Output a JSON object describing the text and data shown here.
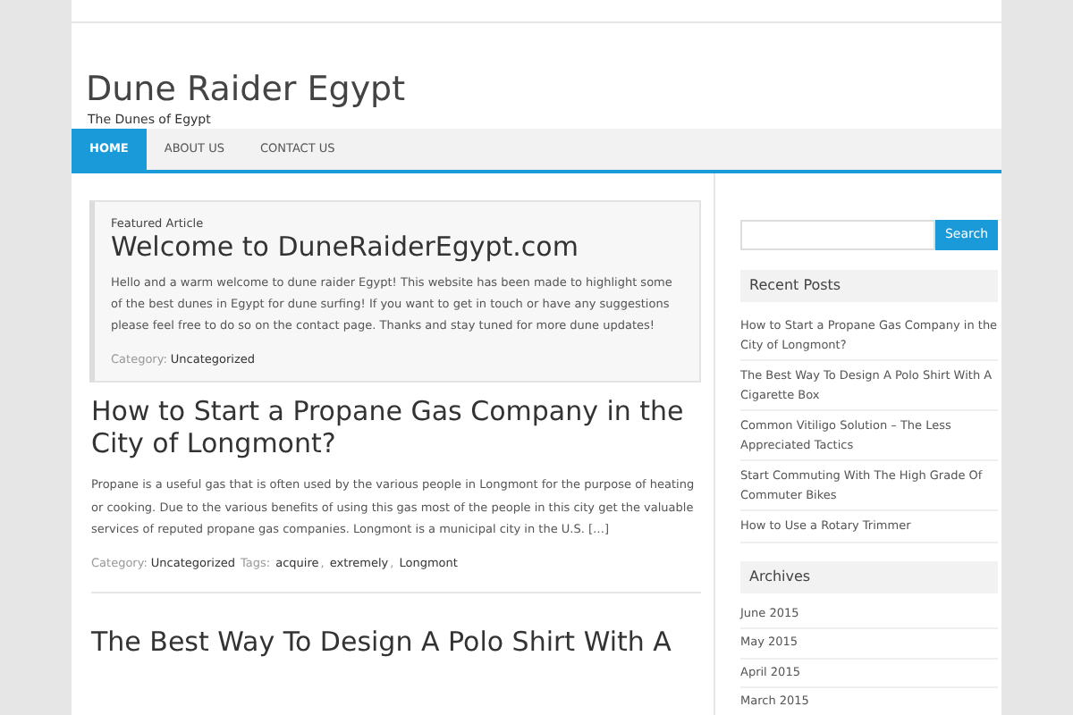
{
  "site": {
    "title": "Dune Raider Egypt",
    "tagline": "The Dunes of Egypt"
  },
  "nav": [
    {
      "label": "HOME",
      "selected": true
    },
    {
      "label": "ABOUT US",
      "selected": false
    },
    {
      "label": "CONTACT US",
      "selected": false
    }
  ],
  "featured": {
    "label": "Featured Article",
    "title": "Welcome to DuneRaiderEgypt.com",
    "body": "Hello and a warm welcome to dune raider Egypt! This website has been made to highlight some of the best dunes in Egypt for dune surfing! If you want to get in touch or have any suggestions please feel free to do so on the contact page. Thanks and stay tuned for more dune updates!",
    "category_label": "Category:",
    "category": "Uncategorized"
  },
  "posts": [
    {
      "title": "How to Start a Propane Gas Company in the City of Longmont?",
      "excerpt": "Propane is a useful gas that is often used by the various people in Longmont for the purpose of heating or cooking. Due to the various benefits of using this gas most of the people in this city get the valuable services of reputed propane gas companies. Longmont is a municipal city in the U.S. […]",
      "category_label": "Category:",
      "category": "Uncategorized",
      "tags_label": "Tags:",
      "tags": [
        "acquire",
        "extremely",
        "Longmont"
      ],
      "tag_separator": ","
    },
    {
      "title": "The Best Way To Design A Polo Shirt With A"
    }
  ],
  "sidebar": {
    "search_button": "Search",
    "recent_title": "Recent Posts",
    "recent": [
      "How to Start a Propane Gas Company in the City of Longmont?",
      "The Best Way To Design A Polo Shirt With A Cigarette Box",
      "Common Vitiligo Solution – The Less Appreciated Tactics",
      "Start Commuting With The High Grade Of Commuter Bikes",
      "How to Use a Rotary Trimmer"
    ],
    "archives_title": "Archives",
    "archives": [
      "June 2015",
      "May 2015",
      "April 2015",
      "March 2015"
    ]
  }
}
